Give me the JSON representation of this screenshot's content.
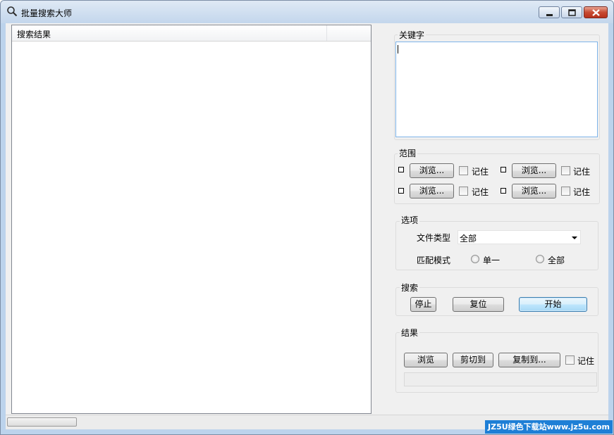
{
  "window": {
    "title": "批量搜索大师"
  },
  "results_list": {
    "column_header": "搜索结果"
  },
  "keyword": {
    "label": "关键字",
    "value": ""
  },
  "scope": {
    "label": "范围",
    "rows": [
      {
        "browse_left": "浏览...",
        "remember_left": "记住",
        "browse_right": "浏览...",
        "remember_right": "记住"
      },
      {
        "browse_left": "浏览...",
        "remember_left": "记住",
        "browse_right": "浏览...",
        "remember_right": "记住"
      }
    ]
  },
  "options": {
    "label": "选项",
    "file_type_label": "文件类型",
    "file_type_value": "全部",
    "match_mode_label": "匹配模式",
    "match_single": "单一",
    "match_all": "全部"
  },
  "search": {
    "label": "搜索",
    "stop": "停止",
    "reset": "复位",
    "start": "开始"
  },
  "results": {
    "label": "结果",
    "browse": "浏览",
    "cut_to": "剪切到",
    "copy_to": "复制到...",
    "remember": "记住"
  },
  "watermark": "JZ5U绿色下载站www.jz5u.com"
}
